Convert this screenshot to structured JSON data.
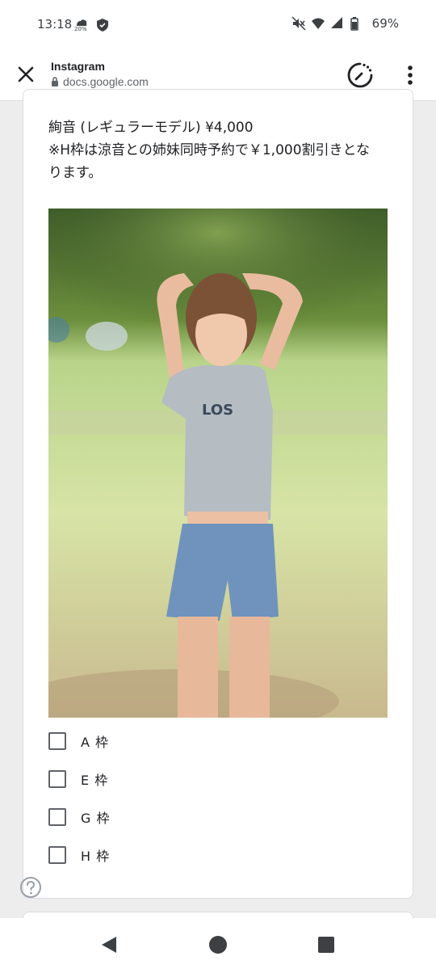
{
  "status_bar": {
    "time": "13:18",
    "data_saver_label": "20%",
    "battery": "69%",
    "icons": [
      "data-saver-icon",
      "shield-icon",
      "mute-icon",
      "wifi-icon",
      "signal-icon",
      "battery-icon"
    ]
  },
  "toolbar": {
    "title": "Instagram",
    "url": "docs.google.com",
    "icons": [
      "close-icon",
      "lock-icon",
      "timer-icon",
      "more-vert-icon"
    ]
  },
  "question": {
    "line1": "絢音 (レギュラーモデル) ¥4,000",
    "line2": "※H枠は涼音との姉妹同時予約で￥1,000割引きとな",
    "line3": "ります。"
  },
  "options": [
    {
      "label": "A 枠",
      "checked": false
    },
    {
      "label": "E 枠",
      "checked": false
    },
    {
      "label": "G 枠",
      "checked": false
    },
    {
      "label": "H 枠",
      "checked": false
    }
  ],
  "help_icon": "help-circle-icon",
  "nav_icons": [
    "back-icon",
    "home-icon",
    "recents-icon"
  ]
}
